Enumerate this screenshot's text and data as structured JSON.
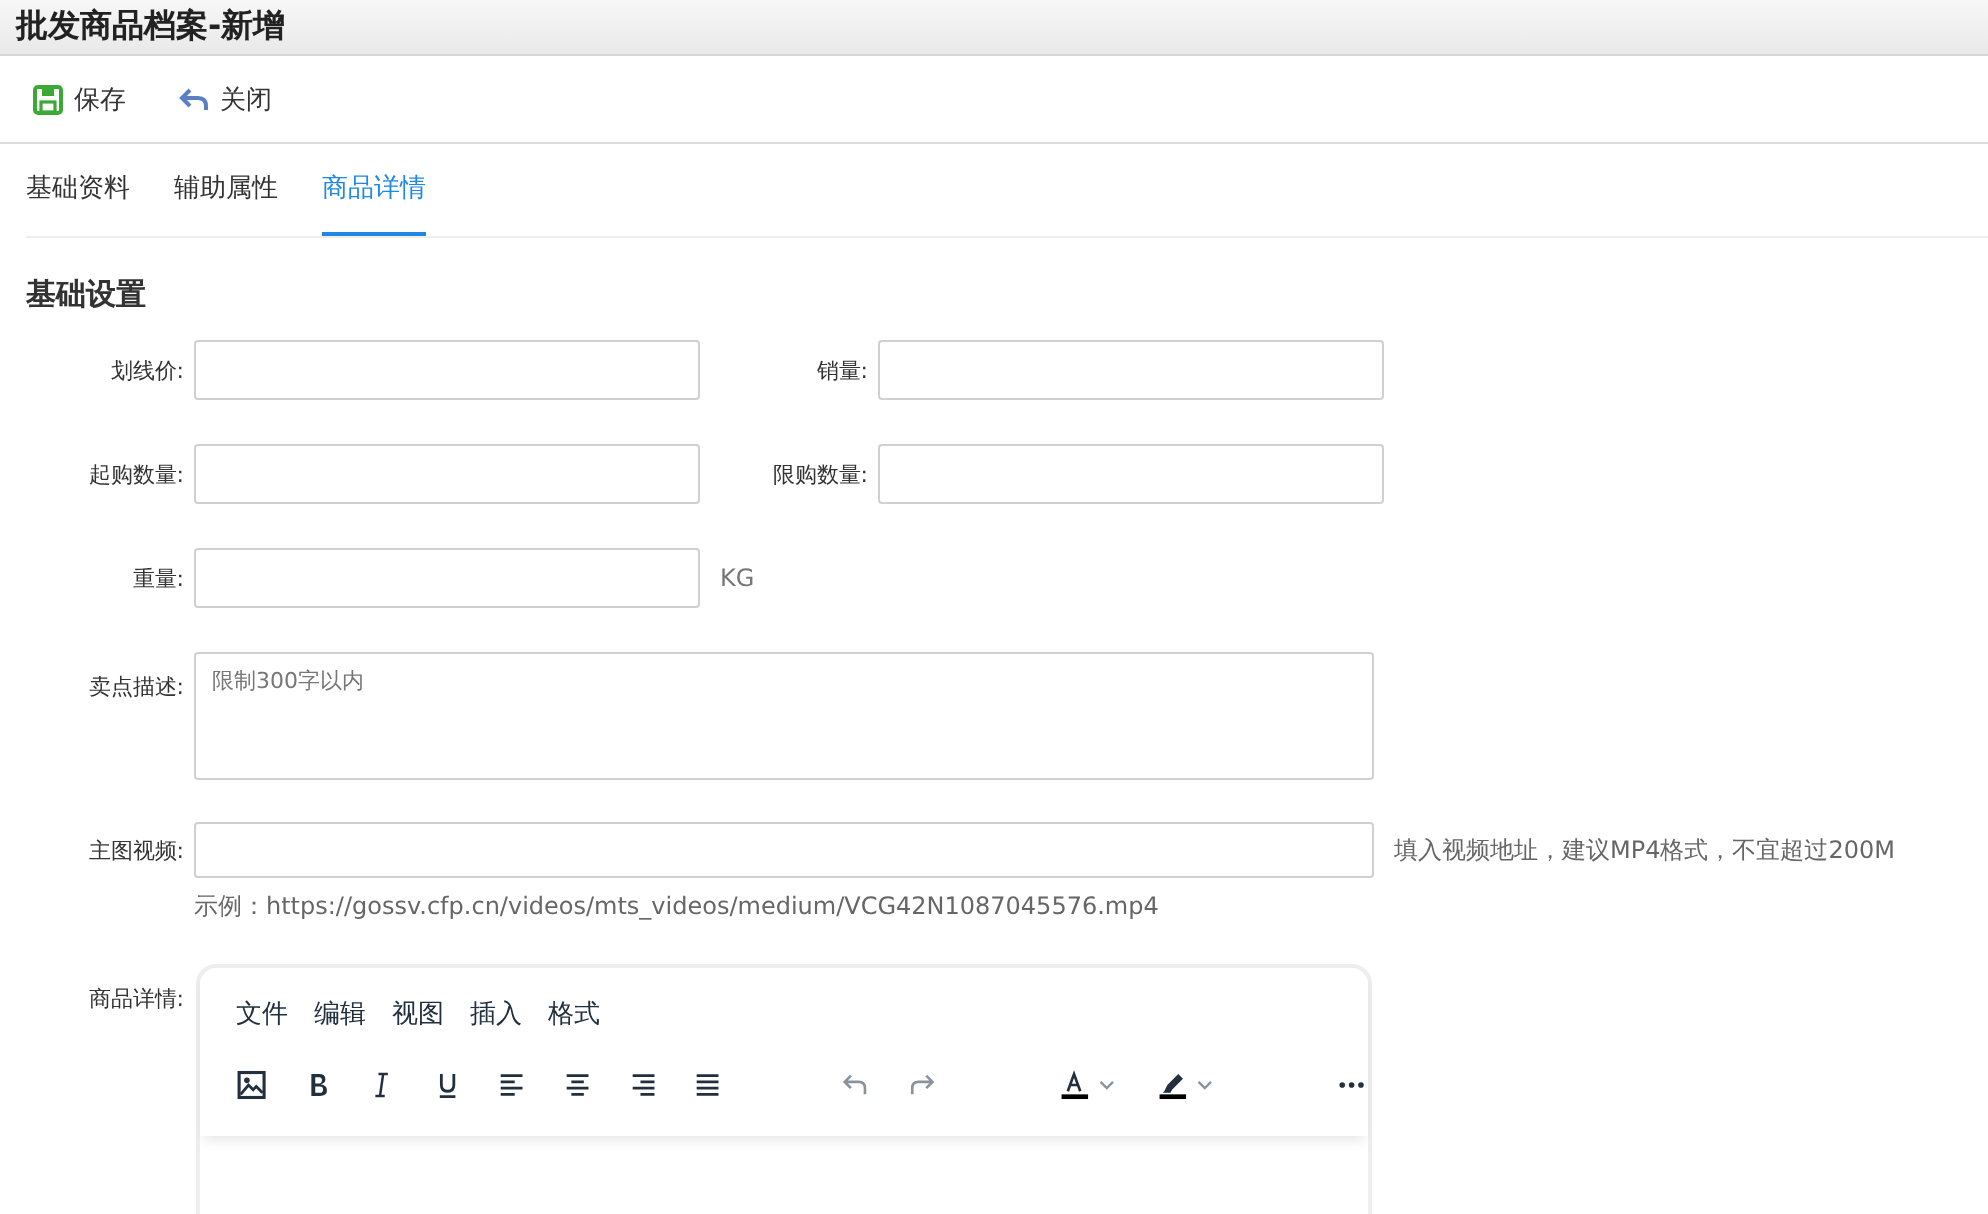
{
  "window": {
    "title": "批发商品档案-新增"
  },
  "toolbar": [
    {
      "kind": "save",
      "label": "保存"
    },
    {
      "kind": "close",
      "label": "关闭"
    }
  ],
  "tabs": [
    {
      "label": "基础资料",
      "selected": false
    },
    {
      "label": "辅助属性",
      "selected": false
    },
    {
      "label": "商品详情",
      "selected": true
    }
  ],
  "section": {
    "title": "基础设置"
  },
  "rows": [
    {
      "fields": [
        {
          "label": "划线价:"
        },
        {
          "label": "销量:"
        }
      ]
    },
    {
      "fields": [
        {
          "label": "起购数量:"
        },
        {
          "label": "限购数量:"
        }
      ]
    },
    {
      "fields": [
        {
          "label": "重量:",
          "unit": "KG"
        }
      ]
    }
  ],
  "description": {
    "label": "卖点描述:",
    "placeholder": "限制300字以内"
  },
  "video": {
    "label": "主图视频:",
    "hint": "填入视频地址，建议MP4格式，不宜超过200M",
    "example": "示例：https://gossv.cfp.cn/videos/mts_videos/medium/VCG42N1087045576.mp4"
  },
  "editor": {
    "label": "商品详情:",
    "menus": [
      "文件",
      "编辑",
      "视图",
      "插入",
      "格式"
    ],
    "tools": [
      {
        "kind": "image"
      },
      {
        "kind": "bold"
      },
      {
        "kind": "italic"
      },
      {
        "kind": "underline"
      },
      {
        "kind": "align-left"
      },
      {
        "kind": "align-center"
      },
      {
        "kind": "align-right"
      },
      {
        "kind": "justify"
      },
      {
        "kind": "undo"
      },
      {
        "kind": "redo"
      },
      {
        "kind": "text-color"
      },
      {
        "kind": "highlight"
      },
      {
        "kind": "more"
      }
    ]
  }
}
